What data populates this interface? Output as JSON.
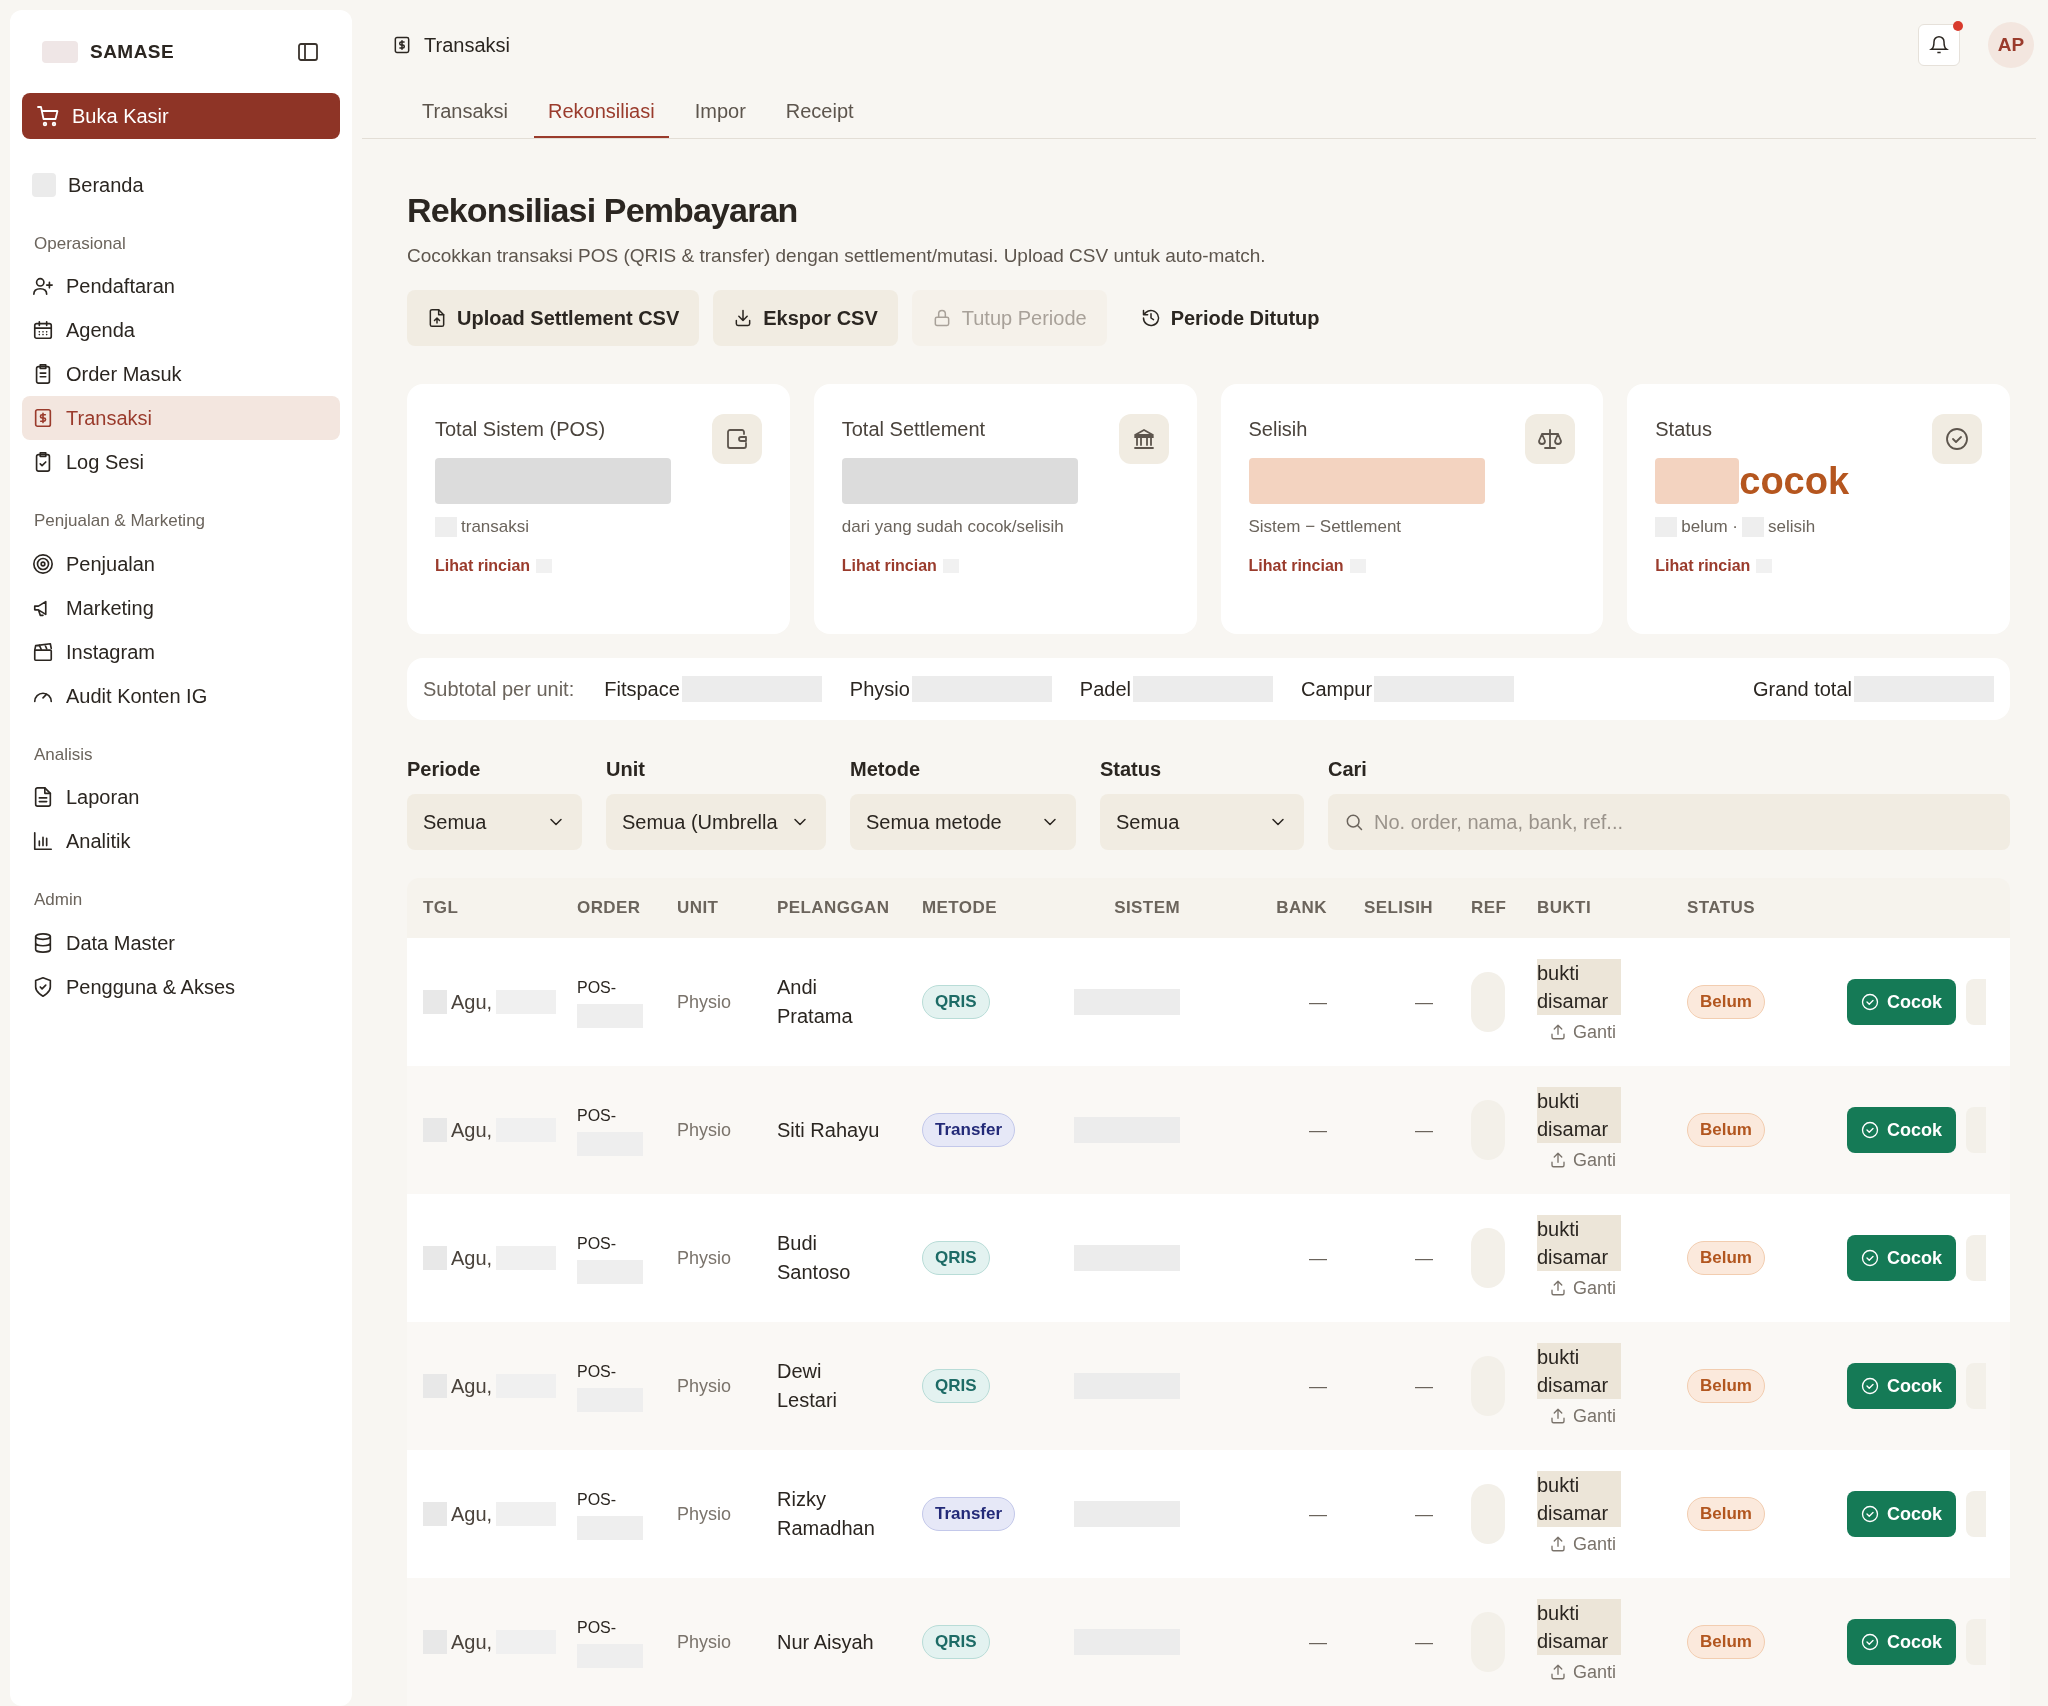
{
  "sidebar": {
    "brand": "SAMASE",
    "primary_button": "Buka Kasir",
    "home": {
      "label": "Beranda",
      "selected": false
    },
    "sections": [
      {
        "title": "Operasional",
        "items": [
          {
            "label": "Pendaftaran",
            "selected": false
          },
          {
            "label": "Agenda",
            "selected": false
          },
          {
            "label": "Order Masuk",
            "selected": false
          },
          {
            "label": "Transaksi",
            "selected": true
          },
          {
            "label": "Log Sesi",
            "selected": false
          }
        ]
      },
      {
        "title": "Penjualan & Marketing",
        "items": [
          {
            "label": "Penjualan",
            "selected": false
          },
          {
            "label": "Marketing",
            "selected": false
          },
          {
            "label": "Instagram",
            "selected": false
          },
          {
            "label": "Audit Konten IG",
            "selected": false
          }
        ]
      },
      {
        "title": "Analisis",
        "items": [
          {
            "label": "Laporan",
            "selected": false
          },
          {
            "label": "Analitik",
            "selected": false
          }
        ]
      },
      {
        "title": "Admin",
        "items": [
          {
            "label": "Data Master",
            "selected": false
          },
          {
            "label": "Pengguna & Akses",
            "selected": false
          }
        ]
      }
    ]
  },
  "header": {
    "title": "Transaksi",
    "notification_unread": true,
    "avatar": "AP"
  },
  "tabs": [
    {
      "label": "Transaksi",
      "selected": false
    },
    {
      "label": "Rekonsiliasi",
      "selected": true
    },
    {
      "label": "Impor",
      "selected": false
    },
    {
      "label": "Receipt",
      "selected": false
    }
  ],
  "page": {
    "title": "Rekonsiliasi Pembayaran",
    "subtitle": "Cocokkan transaksi POS (QRIS & transfer) dengan settlement/mutasi. Upload CSV untuk auto-match.",
    "actions": [
      {
        "label": "Upload Settlement CSV",
        "kind": "filled",
        "disabled": false
      },
      {
        "label": "Ekspor CSV",
        "kind": "filled",
        "disabled": false
      },
      {
        "label": "Tutup Periode",
        "kind": "filled",
        "disabled": true
      },
      {
        "label": "Periode Ditutup",
        "kind": "plain",
        "disabled": false
      }
    ]
  },
  "cards": [
    {
      "title": "Total Sistem (POS)",
      "sub": [
        "transaksi"
      ],
      "sub_blurred": true,
      "link": "Lihat rincian",
      "color": "#dcdcdc"
    },
    {
      "title": "Total Settlement",
      "sub": [
        "dari yang sudah cocok/selisih"
      ],
      "sub_blurred": false,
      "link": "Lihat rincian",
      "color": "#dcdcdc"
    },
    {
      "title": "Selisih",
      "sub": [
        "Sistem − Settlement"
      ],
      "sub_blurred": false,
      "link": "Lihat rincian",
      "color": "#f3d3c0"
    },
    {
      "title": "Status",
      "value": "cocok",
      "sub": [
        "belum ·",
        "selisih"
      ],
      "sub_blurred": true,
      "link": "Lihat rincian",
      "color": "#f3d3c0"
    }
  ],
  "subtotal": {
    "label": "Subtotal per unit:",
    "units": [
      "Fitspace",
      "Physio",
      "Padel",
      "Campur",
      "Grand total"
    ]
  },
  "filters": [
    {
      "label": "Periode",
      "value": "Semua",
      "kind": "select"
    },
    {
      "label": "Unit",
      "value": "Semua (Umbrella",
      "kind": "select"
    },
    {
      "label": "Metode",
      "value": "Semua metode",
      "kind": "select"
    },
    {
      "label": "Status",
      "value": "Semua",
      "kind": "select"
    },
    {
      "label": "Cari",
      "placeholder": "No. order, nama, bank, ref...",
      "kind": "search"
    }
  ],
  "table": {
    "columns": [
      "TGL",
      "ORDER",
      "UNIT",
      "PELANGGAN",
      "METODE",
      "SISTEM",
      "BANK",
      "SELISIH",
      "REF",
      "BUKTI",
      "STATUS"
    ],
    "rows": [
      {
        "date": "Agu,",
        "order": "POS-",
        "unit": "Physio",
        "customer": "Andi Pratama",
        "method": "QRIS",
        "kind": "qris",
        "bank": "—",
        "diff": "—",
        "proof": "bukti disamar",
        "replace": "Ganti",
        "status": "Belum",
        "action": "Cocok"
      },
      {
        "date": "Agu,",
        "order": "POS-",
        "unit": "Physio",
        "customer": "Siti Rahayu",
        "method": "Transfer",
        "kind": "transfer",
        "bank": "—",
        "diff": "—",
        "proof": "bukti disamar",
        "replace": "Ganti",
        "status": "Belum",
        "action": "Cocok"
      },
      {
        "date": "Agu,",
        "order": "POS-",
        "unit": "Physio",
        "customer": "Budi Santoso",
        "method": "QRIS",
        "kind": "qris",
        "bank": "—",
        "diff": "—",
        "proof": "bukti disamar",
        "replace": "Ganti",
        "status": "Belum",
        "action": "Cocok"
      },
      {
        "date": "Agu,",
        "order": "POS-",
        "unit": "Physio",
        "customer": "Dewi Lestari",
        "method": "QRIS",
        "kind": "qris",
        "bank": "—",
        "diff": "—",
        "proof": "bukti disamar",
        "replace": "Ganti",
        "status": "Belum",
        "action": "Cocok"
      },
      {
        "date": "Agu,",
        "order": "POS-",
        "unit": "Physio",
        "customer": "Rizky Ramadhan",
        "method": "Transfer",
        "kind": "transfer",
        "bank": "—",
        "diff": "—",
        "proof": "bukti disamar",
        "replace": "Ganti",
        "status": "Belum",
        "action": "Cocok"
      },
      {
        "date": "Agu,",
        "order": "POS-",
        "unit": "Physio",
        "customer": "Nur Aisyah",
        "method": "QRIS",
        "kind": "qris",
        "bank": "—",
        "diff": "—",
        "proof": "bukti disamar",
        "replace": "Ganti",
        "status": "Belum",
        "action": "Cocok"
      }
    ]
  }
}
